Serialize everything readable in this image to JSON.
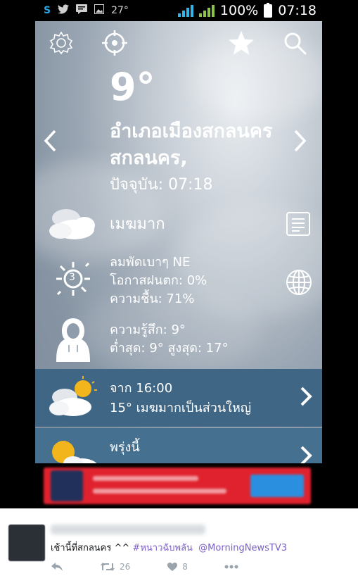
{
  "status_bar": {
    "left_icons": [
      "skype-icon",
      "twitter-icon",
      "chat-icon",
      "image-icon"
    ],
    "temperature": "27°",
    "battery": "100%",
    "time": "07:18"
  },
  "weather": {
    "temperature": "9°",
    "location": "อำเภอเมืองสกลนคร สกลนคร,",
    "updated": "ปัจจุบัน: 07:18",
    "condition": "เมฆมาก",
    "wind": "ลมพัดเบาๆ NE",
    "rain_chance": "โอกาสฝนตก: 0%",
    "humidity": "ความชื้น: 71%",
    "uv_index": "3",
    "feels_like": "ความรู้สึก: 9°",
    "min_max": "ต่ำสุด: 9° สูงสุด: 17°",
    "forecasts": [
      {
        "line1": "จาก 16:00",
        "line2": "15° เมฆมากเป็นส่วนใหญ่"
      },
      {
        "line1": "พรุ่งนี้",
        "line2": ""
      }
    ]
  },
  "tweet": {
    "text_prefix": "เช้านี้ที่สกลนคร ^^ ",
    "hashtag": "#หนาวฉับพลัน",
    "mention": "@MorningNewsTV3",
    "retweets": "26",
    "likes": "8"
  },
  "colors": {
    "forecast_row_1": "#3f6684",
    "forecast_row_2": "#46708f",
    "ad_background": "#e0222e",
    "link_purple": "#7b5ec6"
  }
}
